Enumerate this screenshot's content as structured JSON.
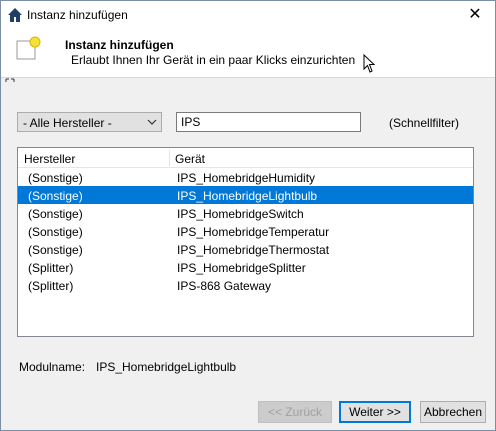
{
  "window": {
    "title": "Instanz hinzufügen",
    "close_glyph": "✕"
  },
  "header": {
    "title": "Instanz hinzufügen",
    "subtitle": "Erlaubt Ihnen Ihr Gerät in ein paar Klicks einzurichten"
  },
  "filter": {
    "manufacturer_selected": "- Alle Hersteller -",
    "search_value": "IPS",
    "quick_filter_label": "(Schnellfilter)"
  },
  "list": {
    "columns": [
      "Hersteller",
      "Gerät"
    ],
    "rows": [
      {
        "manufacturer": "(Sonstige)",
        "device": "IPS_HomebridgeHumidity",
        "selected": false
      },
      {
        "manufacturer": "(Sonstige)",
        "device": "IPS_HomebridgeLightbulb",
        "selected": true
      },
      {
        "manufacturer": "(Sonstige)",
        "device": "IPS_HomebridgeSwitch",
        "selected": false
      },
      {
        "manufacturer": "(Sonstige)",
        "device": "IPS_HomebridgeTemperatur",
        "selected": false
      },
      {
        "manufacturer": "(Sonstige)",
        "device": "IPS_HomebridgeThermostat",
        "selected": false
      },
      {
        "manufacturer": "(Splitter)",
        "device": "IPS_HomebridgeSplitter",
        "selected": false
      },
      {
        "manufacturer": "(Splitter)",
        "device": "IPS-868 Gateway",
        "selected": false
      }
    ]
  },
  "module": {
    "label": "Modulname:",
    "value": "IPS_HomebridgeLightbulb"
  },
  "buttons": {
    "back": "<< Zurück",
    "next": "Weiter >>",
    "cancel": "Abbrechen"
  },
  "colors": {
    "selection": "#0078d7",
    "dialog_bg": "#f0f0f0"
  },
  "icons": [
    "home-icon",
    "close-icon",
    "new-instance-icon",
    "mouse-cursor-icon",
    "resize-grip-icon",
    "chevron-down-icon"
  ]
}
